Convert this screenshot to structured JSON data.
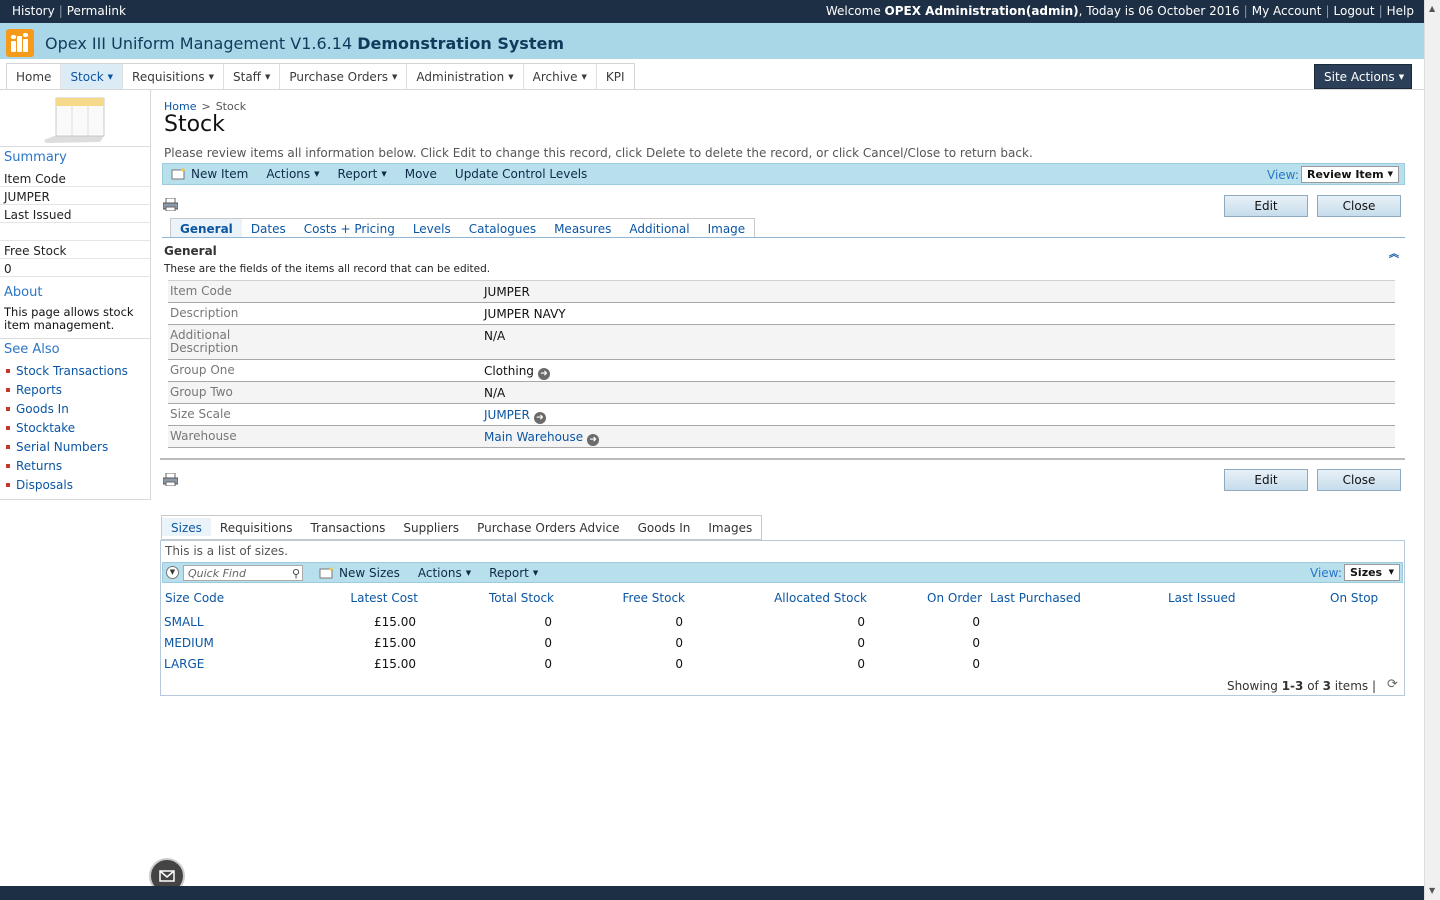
{
  "topbar": {
    "history": "History",
    "permalink": "Permalink",
    "welcome_prefix": "Welcome ",
    "user": "OPEX Administration(admin)",
    "today": ", Today is 06 October 2016",
    "my_account": "My Account",
    "logout": "Logout",
    "help": "Help"
  },
  "app": {
    "title": "Opex III Uniform Management V1.6.14",
    "subtitle": "Demonstration System"
  },
  "nav": {
    "items": [
      {
        "label": "Home"
      },
      {
        "label": "Stock"
      },
      {
        "label": "Requisitions"
      },
      {
        "label": "Staff"
      },
      {
        "label": "Purchase Orders"
      },
      {
        "label": "Administration"
      },
      {
        "label": "Archive"
      },
      {
        "label": "KPI"
      }
    ],
    "site_actions": "Site Actions"
  },
  "left": {
    "summary": "Summary",
    "item_code_label": "Item Code",
    "item_code_value": "JUMPER",
    "last_issued_label": "Last Issued",
    "last_issued_value": "",
    "free_stock_label": "Free Stock",
    "free_stock_value": "0",
    "about": "About",
    "about_text": "This page allows stock item management.",
    "see_also": "See Also",
    "links": [
      "Stock Transactions",
      "Reports",
      "Goods In",
      "Stocktake",
      "Serial Numbers",
      "Returns",
      "Disposals"
    ]
  },
  "breadcrumb": {
    "home": "Home",
    "arrow": ">",
    "current": "Stock"
  },
  "page_title": "Stock",
  "intro": "Please review items all information below. Click Edit to change this record, click Delete to delete the record, or click Cancel/Close to return back.",
  "toolbar": {
    "new_item": "New Item",
    "actions": "Actions",
    "report": "Report",
    "move": "Move",
    "update_control": "Update Control Levels",
    "view_label": "View:",
    "view_value": "Review Item"
  },
  "buttons": {
    "edit": "Edit",
    "close": "Close"
  },
  "tabs": [
    "General",
    "Dates",
    "Costs + Pricing",
    "Levels",
    "Catalogues",
    "Measures",
    "Additional",
    "Image"
  ],
  "section": {
    "title": "General",
    "desc": "These are the fields of the items all record that can be edited."
  },
  "fields": [
    {
      "label": "Item Code",
      "value": "JUMPER",
      "link": false
    },
    {
      "label": "Description",
      "value": "JUMPER NAVY",
      "link": false
    },
    {
      "label": "Additional Description",
      "value": "N/A",
      "link": false
    },
    {
      "label": "Group One",
      "value": "Clothing",
      "link": false,
      "go": true
    },
    {
      "label": "Group Two",
      "value": "N/A",
      "link": false
    },
    {
      "label": "Size Scale",
      "value": "JUMPER",
      "link": true,
      "go": true
    },
    {
      "label": "Warehouse",
      "value": "Main Warehouse",
      "link": true,
      "go": true
    }
  ],
  "list_tabs": [
    "Sizes",
    "Requisitions",
    "Transactions",
    "Suppliers",
    "Purchase Orders Advice",
    "Goods In",
    "Images"
  ],
  "list": {
    "desc": "This is a list of sizes.",
    "quickfind_placeholder": "Quick Find",
    "new_sizes": "New Sizes",
    "actions": "Actions",
    "report": "Report",
    "view_label": "View:",
    "view_value": "Sizes",
    "headers": [
      "Size Code",
      "Latest Cost",
      "Total Stock",
      "Free Stock",
      "Allocated Stock",
      "On Order",
      "Last Purchased",
      "Last Issued",
      "On Stop"
    ],
    "rows": [
      [
        "SMALL",
        "£15.00",
        "0",
        "0",
        "0",
        "0",
        "",
        "",
        ""
      ],
      [
        "MEDIUM",
        "£15.00",
        "0",
        "0",
        "0",
        "0",
        "",
        "",
        ""
      ],
      [
        "LARGE",
        "£15.00",
        "0",
        "0",
        "0",
        "0",
        "",
        "",
        ""
      ]
    ],
    "showing_prefix": "Showing ",
    "showing_range": "1-3",
    "showing_of": " of ",
    "showing_total": "3",
    "showing_suffix": " items"
  },
  "icons": {
    "print": "print-icon",
    "go": "arrow-right-circle-icon",
    "collapse": "double-chevron-up-icon",
    "refresh": "refresh-icon",
    "email": "email-icon"
  },
  "colors": {
    "topbar": "#1d2f44",
    "titlebar": "#a9d7e8",
    "toolbar": "#b7dfec",
    "link": "#0b56a3",
    "logo": "#f59a1b"
  }
}
